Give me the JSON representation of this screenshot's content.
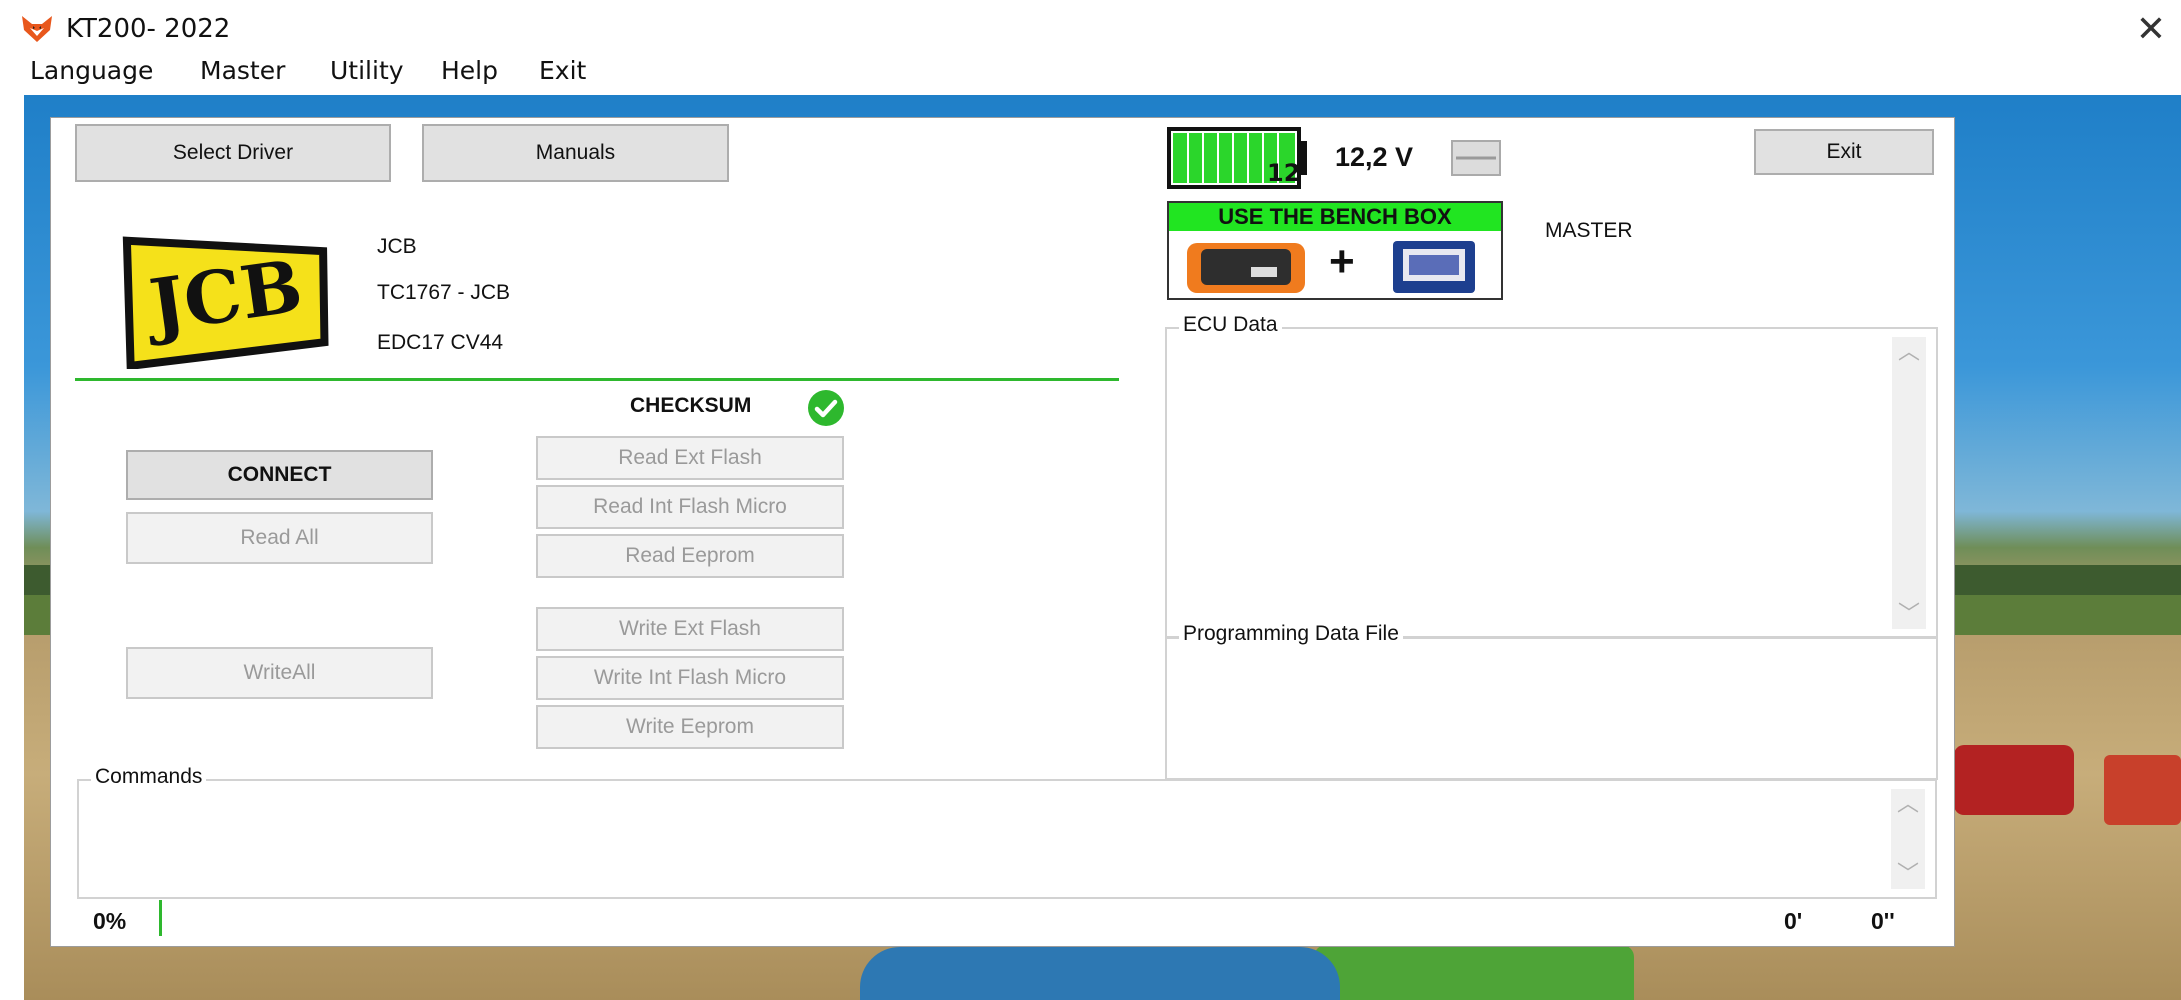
{
  "window": {
    "title": "KT200- 2022"
  },
  "menu": [
    "Language",
    "Master",
    "Utility",
    "Help",
    "Exit"
  ],
  "top_buttons": {
    "select_driver": "Select Driver",
    "manuals": "Manuals",
    "exit": "Exit"
  },
  "vehicle": {
    "logo_text": "JCB",
    "make": "JCB",
    "ecu_model": "TC1767 - JCB",
    "ecu_type": "EDC17 CV44"
  },
  "checksum": {
    "label": "CHECKSUM",
    "status": "ok"
  },
  "left_actions": {
    "connect": "CONNECT",
    "read_all": "Read All",
    "write_all": "WriteAll"
  },
  "read_actions": [
    "Read Ext Flash",
    "Read Int Flash Micro",
    "Read Eeprom"
  ],
  "write_actions": [
    "Write Ext Flash",
    "Write Int Flash Micro",
    "Write Eeprom"
  ],
  "battery": {
    "level": "12",
    "voltage": "12,2 V",
    "fill_fraction": 1.0
  },
  "bench_box": {
    "title": "USE THE BENCH BOX",
    "plus": "+"
  },
  "mode": "MASTER",
  "groups": {
    "ecu_data": "ECU Data",
    "programming_file": "Programming Data File",
    "commands": "Commands"
  },
  "status": {
    "progress": "0%",
    "minutes": "0'",
    "seconds": "0''"
  },
  "colors": {
    "accent_green": "#2eb82e",
    "bench_green": "#21e521",
    "logo_yellow": "#f5e11a"
  }
}
